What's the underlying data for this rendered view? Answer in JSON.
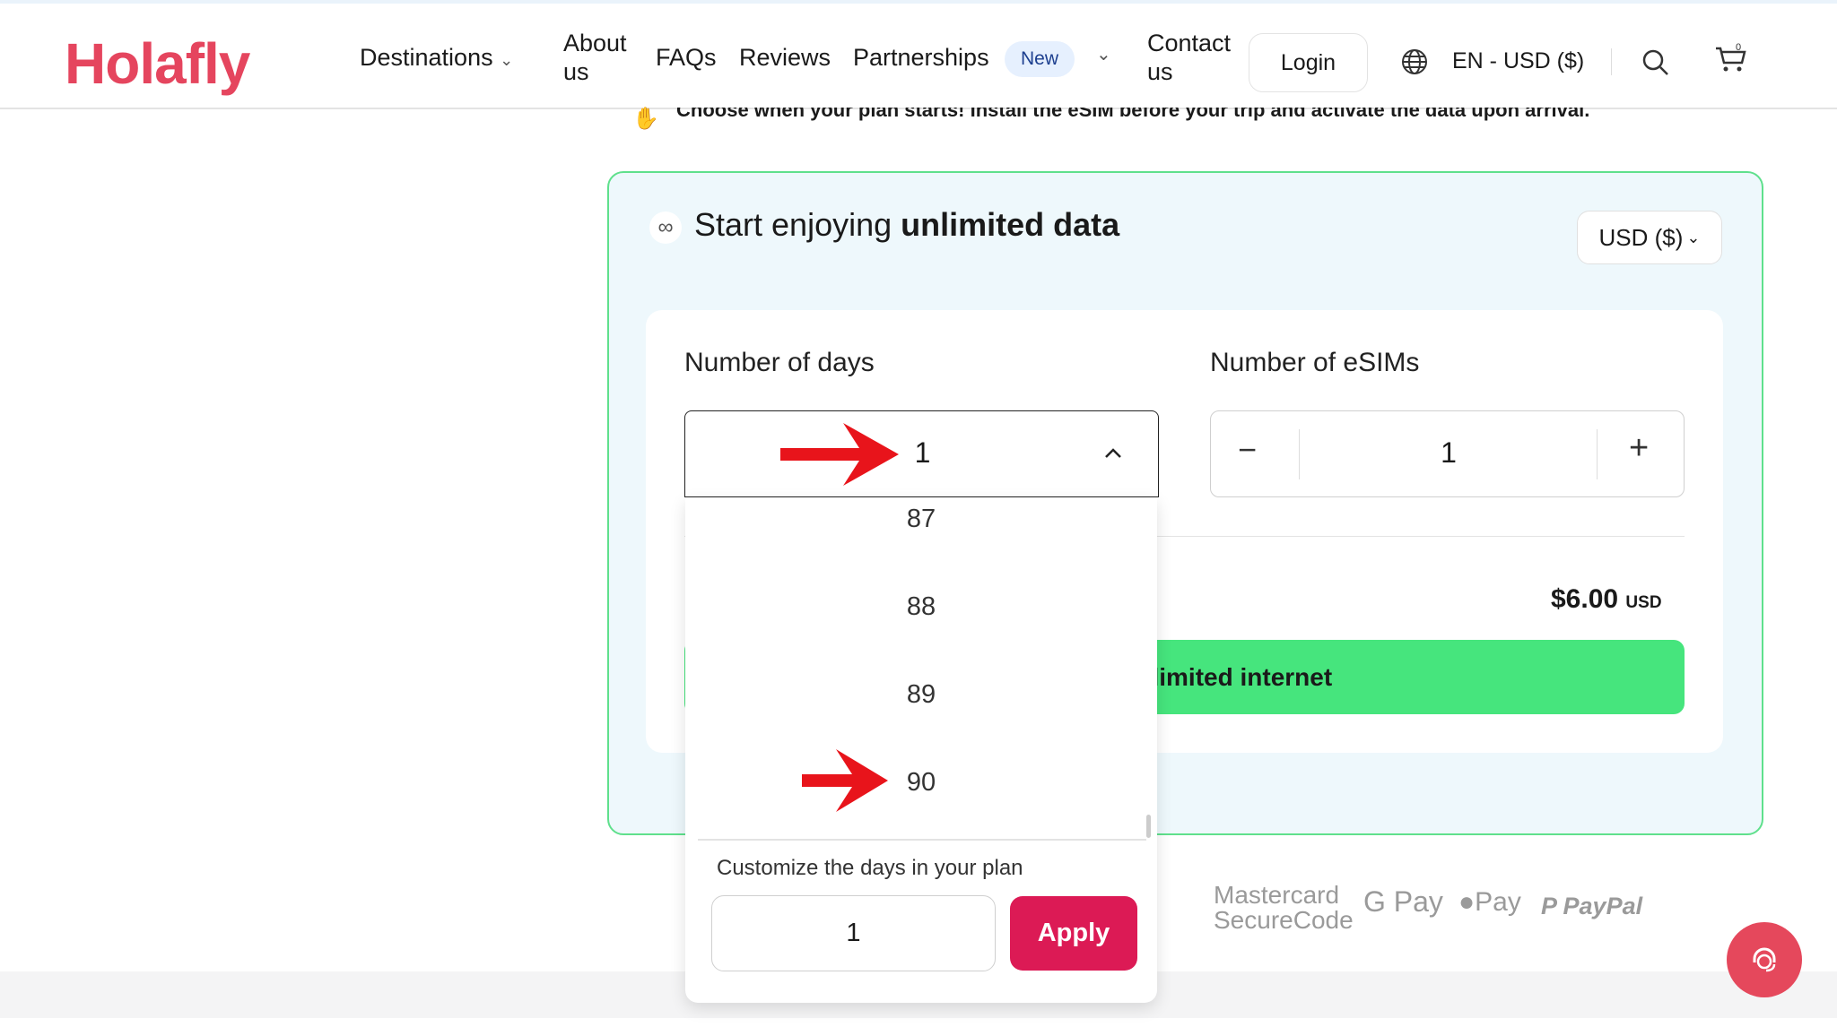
{
  "header": {
    "logo": "Holafly",
    "nav": [
      "Destinations",
      "About us",
      "FAQs",
      "Reviews",
      "Partnerships",
      "Contact us"
    ],
    "new_badge": "New",
    "login": "Login",
    "locale": "EN - USD ($)",
    "cart_count": "0"
  },
  "notice": "Choose when your plan starts! Install the eSIM before your trip and activate the data upon arrival.",
  "card": {
    "title_prefix": "Start enjoying ",
    "title_bold": "unlimited data",
    "currency": "USD ($)",
    "days_label": "Number of days",
    "days_value": "1",
    "esims_label": "Number of eSIMs",
    "esims_value": "1",
    "price": "$6.00",
    "price_unit": "USD",
    "cta": "Get unlimited internet"
  },
  "dropdown": {
    "options": [
      "87",
      "88",
      "89",
      "90"
    ],
    "customize_label": "Customize the days in your plan",
    "custom_value": "1",
    "apply": "Apply"
  },
  "payments": [
    "Mastercard",
    "SecureCode",
    "G Pay",
    "Pay",
    "PayPal"
  ],
  "colors": {
    "brand": "#e5455e",
    "cta": "#46e57d",
    "apply": "#dc1a55",
    "annotation_arrow": "#e8141b"
  }
}
